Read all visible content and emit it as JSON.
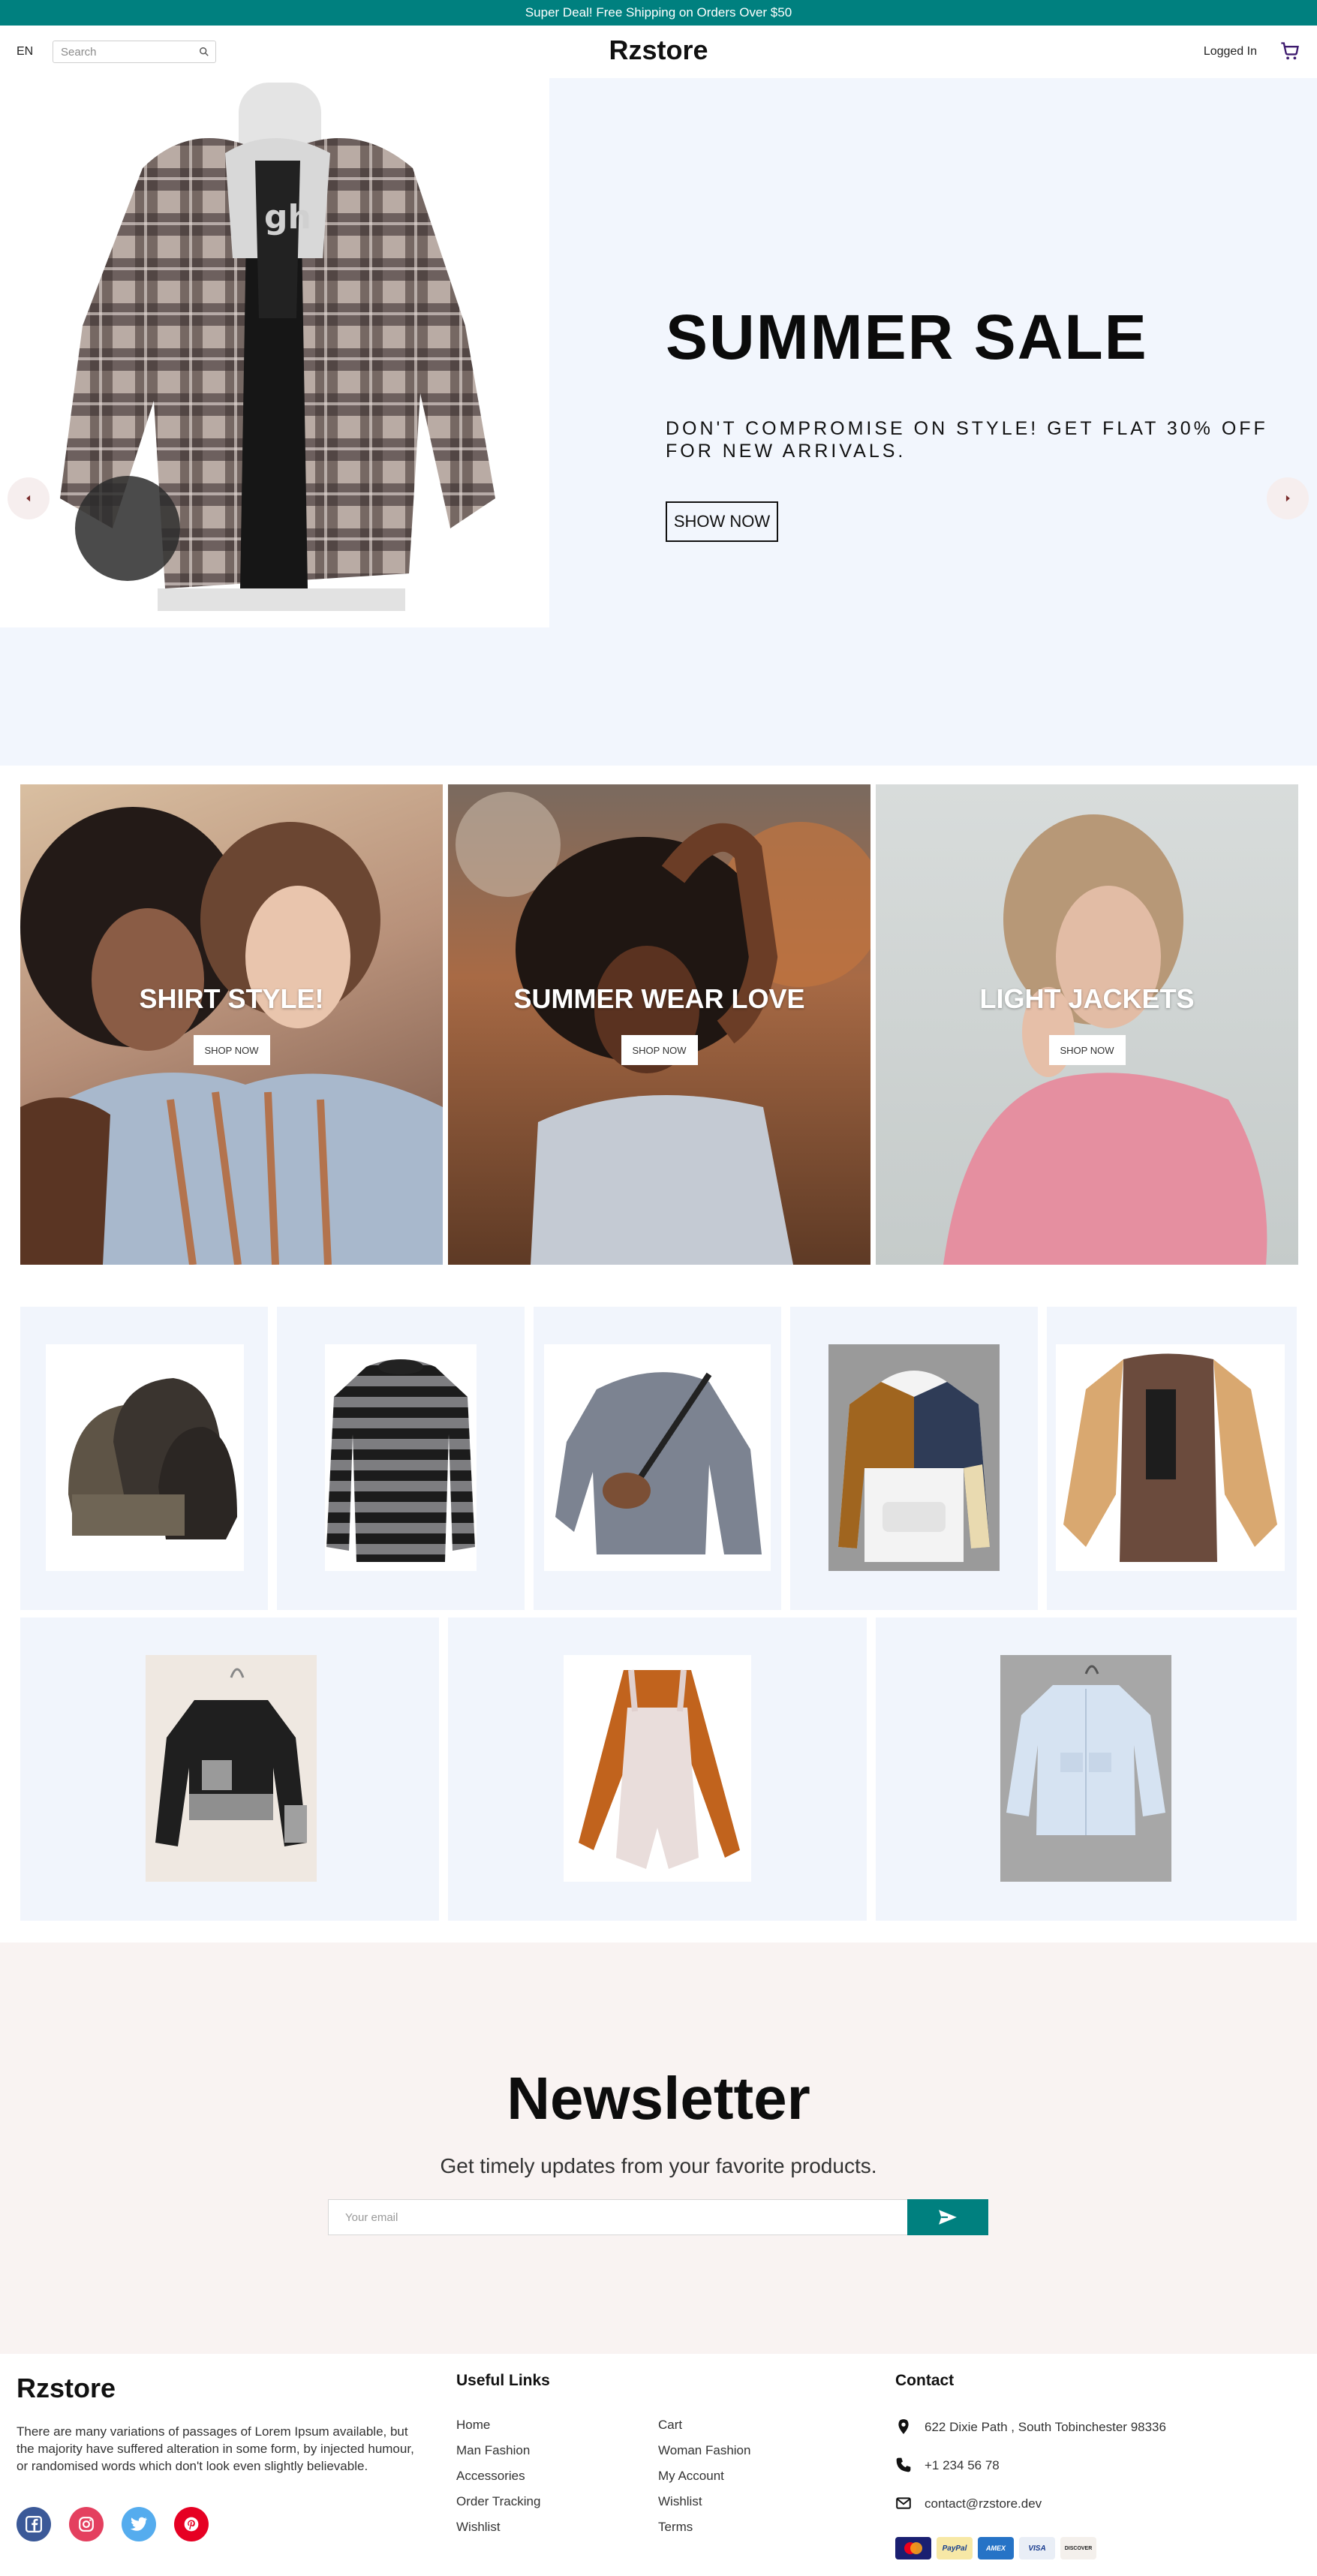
{
  "announcement": "Super Deal! Free Shipping on Orders Over $50",
  "header": {
    "language": "EN",
    "search_placeholder": "Search",
    "brand": "Rzstore",
    "login": "Logged In"
  },
  "hero": {
    "title": "SUMMER SALE",
    "subtitle": "DON'T COMPROMISE ON STYLE! GET FLAT 30% OFF FOR NEW ARRIVALS.",
    "button": "SHOW NOW"
  },
  "categories": [
    {
      "title": "SHIRT STYLE!",
      "button": "SHOP NOW"
    },
    {
      "title": "SUMMER WEAR LOVE",
      "button": "SHOP NOW"
    },
    {
      "title": "LIGHT JACKETS",
      "button": "SHOP NOW"
    }
  ],
  "newsletter": {
    "title": "Newsletter",
    "subtitle": "Get timely updates from your favorite products.",
    "placeholder": "Your email"
  },
  "footer": {
    "brand": "Rzstore",
    "description": "There are many variations of passages of Lorem Ipsum available, but the majority have suffered alteration in some form, by injected humour, or randomised words which don't look even slightly believable.",
    "useful_links_heading": "Useful Links",
    "links_col1": [
      "Home",
      "Man Fashion",
      "Accessories",
      "Order Tracking",
      "Wishlist"
    ],
    "links_col2": [
      "Cart",
      "Woman Fashion",
      "My Account",
      "Wishlist",
      "Terms"
    ],
    "contact_heading": "Contact",
    "address": "622 Dixie Path , South Tobinchester 98336",
    "phone": "+1 234 56 78",
    "email": "contact@rzstore.dev",
    "payment": [
      "MC",
      "PayPal",
      "AMEX",
      "VISA",
      "DISCOVER"
    ]
  },
  "colors": {
    "accent": "#00807f",
    "hero_bg": "#f2f6fd",
    "newsletter_bg": "#f9f3f2",
    "card_bg": "#f1f5fc"
  }
}
